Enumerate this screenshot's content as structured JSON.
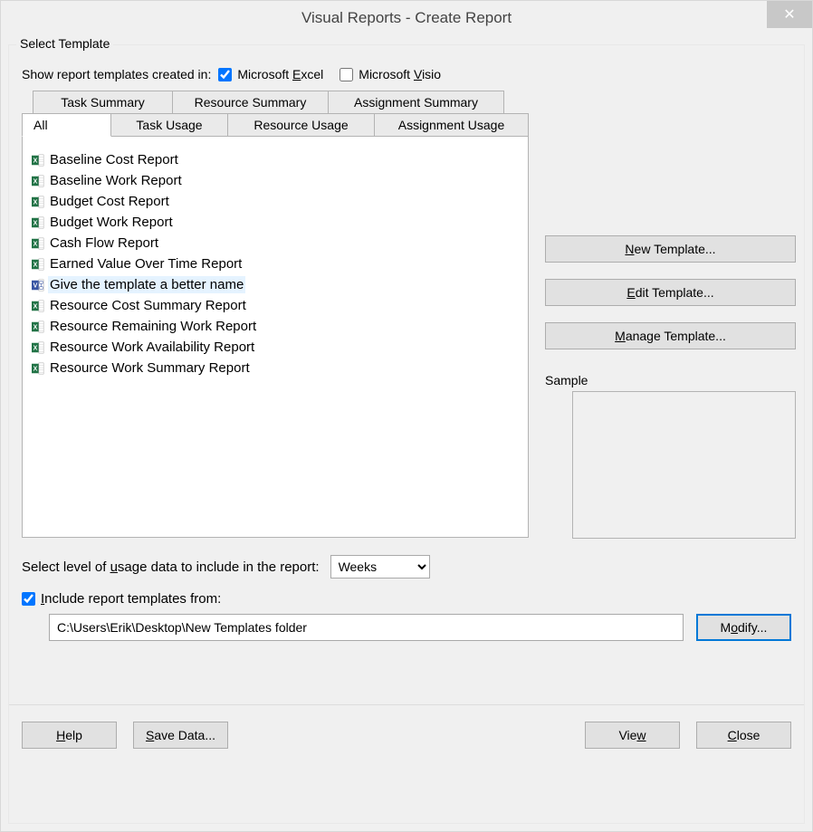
{
  "window": {
    "title": "Visual Reports - Create Report",
    "close": "✕"
  },
  "group_label": "Select Template",
  "filter": {
    "label": "Show report templates created in:",
    "excel": {
      "label_pre": "Microsoft ",
      "label_u": "E",
      "label_post": "xcel",
      "checked": true
    },
    "visio": {
      "label_pre": "Microsoft ",
      "label_u": "V",
      "label_post": "isio",
      "checked": false
    }
  },
  "tabs": {
    "row1": [
      {
        "label": "Task Summary"
      },
      {
        "label": "Resource Summary"
      },
      {
        "label": "Assignment Summary"
      }
    ],
    "row2": [
      {
        "label": "All",
        "active": true
      },
      {
        "label": "Task Usage"
      },
      {
        "label": "Resource Usage"
      },
      {
        "label": "Assignment Usage"
      }
    ]
  },
  "templates": [
    {
      "name": "Baseline Cost Report",
      "icon": "excel"
    },
    {
      "name": "Baseline Work Report",
      "icon": "excel"
    },
    {
      "name": "Budget Cost Report",
      "icon": "excel"
    },
    {
      "name": "Budget Work Report",
      "icon": "excel"
    },
    {
      "name": "Cash Flow Report",
      "icon": "excel"
    },
    {
      "name": "Earned Value Over Time Report",
      "icon": "excel"
    },
    {
      "name": "Give the template a better name",
      "icon": "visio",
      "selected": true
    },
    {
      "name": "Resource Cost Summary Report",
      "icon": "excel"
    },
    {
      "name": "Resource Remaining Work Report",
      "icon": "excel"
    },
    {
      "name": "Resource Work Availability Report",
      "icon": "excel"
    },
    {
      "name": "Resource Work Summary Report",
      "icon": "excel"
    }
  ],
  "buttons": {
    "new_template": {
      "u": "N",
      "post": "ew Template..."
    },
    "edit_template": {
      "u": "E",
      "post": "dit Template..."
    },
    "manage_template": {
      "u": "M",
      "post": "anage Template..."
    }
  },
  "sample_label": "Sample",
  "usage": {
    "label_pre": "Select level of ",
    "label_u": "u",
    "label_post": "sage data to include in the report:",
    "selected": "Weeks"
  },
  "include": {
    "label_u": "I",
    "label_post": "nclude report templates from:",
    "checked": true,
    "path": "C:\\Users\\Erik\\Desktop\\New Templates folder"
  },
  "modify": {
    "pre": "M",
    "u": "o",
    "post": "dify..."
  },
  "footer": {
    "help": {
      "u": "H",
      "post": "elp"
    },
    "save_data": {
      "u": "S",
      "post": "ave Data..."
    },
    "view": {
      "pre": "Vie",
      "u": "w"
    },
    "close": {
      "u": "C",
      "post": "lose"
    }
  }
}
